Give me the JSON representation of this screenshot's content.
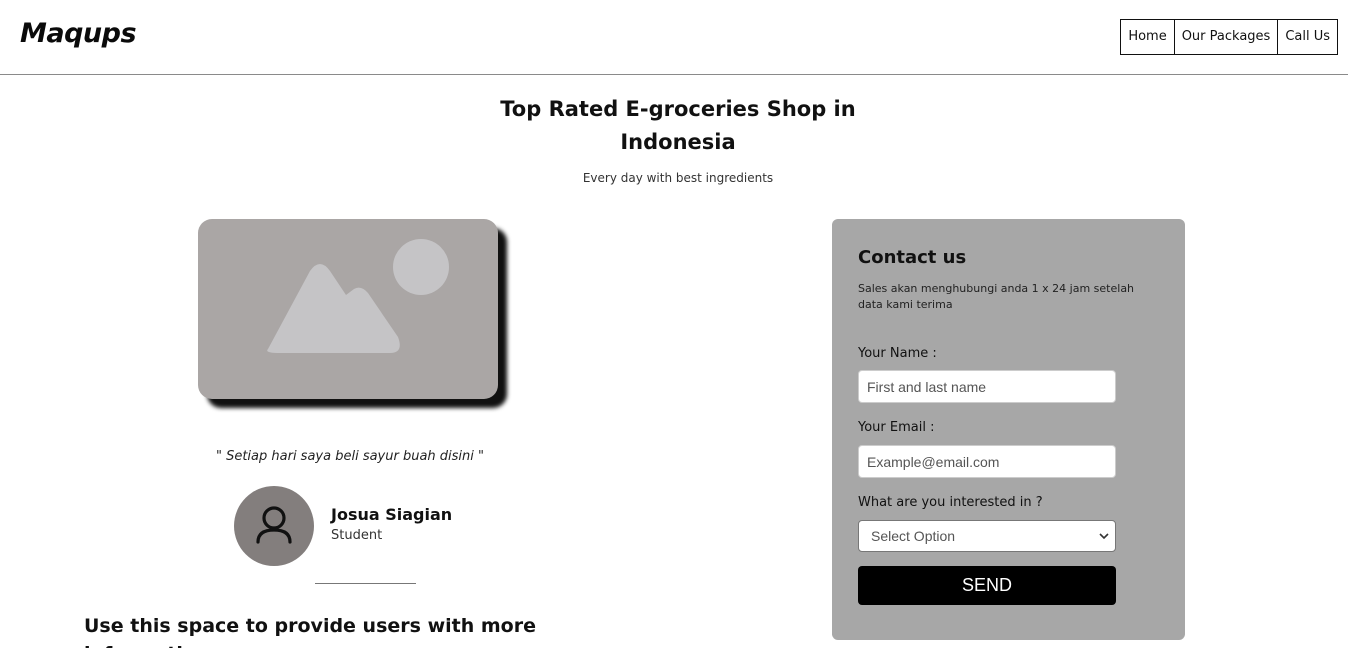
{
  "header": {
    "logo": "Maqups",
    "nav": [
      "Home",
      "Our Packages",
      "Call Us"
    ]
  },
  "hero": {
    "title": "Top Rated E-groceries Shop in Indonesia",
    "subtitle": "Every day with best ingredients"
  },
  "testimonial": {
    "image_icon": "image-placeholder-icon",
    "quote": "\" Setiap hari saya beli sayur buah disini \"",
    "avatar_icon": "user-icon",
    "name": "Josua Siagian",
    "role": "Student"
  },
  "info": {
    "text": "Use this space to provide users with more information"
  },
  "contact": {
    "title": "Contact us",
    "description": "Sales akan menghubungi anda 1 x 24 jam setelah data kami terima",
    "name_label": "Your Name :",
    "name_placeholder": "First and last name",
    "email_label": "Your Email :",
    "email_placeholder": "Example@email.com",
    "interest_label": "What are you interested in ?",
    "select_value": "Select Option",
    "send_label": "SEND"
  },
  "colors": {
    "card_background": "#a7a7a7",
    "image_background": "#aaa6a5",
    "avatar_background": "#837e7d",
    "button_background": "#000000"
  }
}
